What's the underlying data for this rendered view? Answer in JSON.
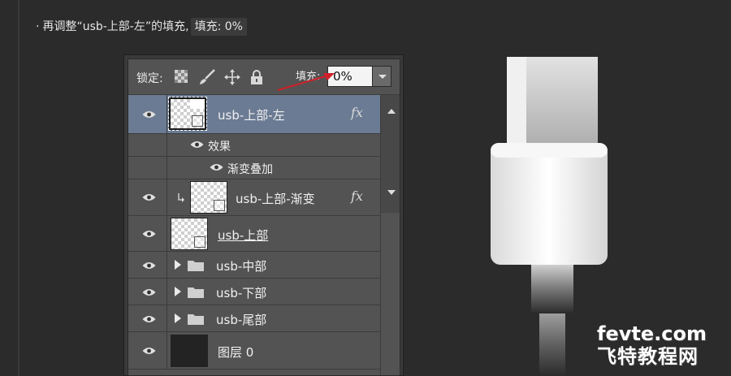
{
  "instruction": {
    "bullet": "·",
    "text": "再调整“usb-上部-左”的填充,",
    "code": "填充: 0%"
  },
  "lockbar": {
    "lock_label": "锁定:",
    "lock_icons": [
      "lock-transparent-icon",
      "lock-paint-icon",
      "lock-position-icon",
      "lock-all-icon"
    ],
    "fill_label": "填充:",
    "fill_value": "0%"
  },
  "layers": [
    {
      "name": "usb-上部-左",
      "fx": "fx",
      "selected": true,
      "thumb": "transparent-with-mask"
    },
    {
      "name": "效果",
      "kind": "effects-group"
    },
    {
      "name": "渐变叠加",
      "kind": "effect"
    },
    {
      "name": "usb-上部-渐变",
      "fx": "fx",
      "clipped": true,
      "thumb": "transparent-with-mask"
    },
    {
      "name": "usb-上部",
      "underlined": true,
      "thumb": "transparent-with-mask"
    },
    {
      "name": "usb-中部",
      "kind": "group"
    },
    {
      "name": "usb-下部",
      "kind": "group"
    },
    {
      "name": "usb-尾部",
      "kind": "group"
    },
    {
      "name": "图层 0",
      "thumb": "dark"
    }
  ],
  "annotation": {
    "arrow_color": "#d0202a"
  },
  "watermark": {
    "line1": "fevte.com",
    "line2": "飞特教程网"
  },
  "colors": {
    "background": "#2b2b2b",
    "panel": "#535353",
    "selection": "#6b7b93"
  }
}
